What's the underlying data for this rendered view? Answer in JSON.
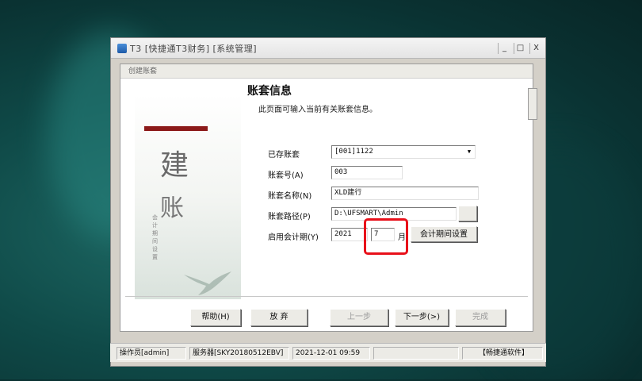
{
  "window": {
    "title": "T3 [快捷通T3财务] [系统管理]",
    "controls": [
      "_",
      "□",
      "X"
    ]
  },
  "dialog": {
    "title": "创建账套"
  },
  "side_panel": {
    "char1": "建",
    "char2": "账",
    "vertical_text": "会计期间设置"
  },
  "content": {
    "title": "账套信息",
    "subtitle": "此页面可输入当前有关账套信息。"
  },
  "form": {
    "existing_label": "已存账套",
    "existing_value": "[001]1122",
    "number_label": "账套号(A)",
    "number_value": "003",
    "name_label": "账套名称(N)",
    "name_value": "XLD建行",
    "path_label": "账套路径(P)",
    "path_value": "D:\\UFSMART\\Admin",
    "period_label": "启用会计期(Y)",
    "period_year": "2021",
    "period_month": "7",
    "month_unit": "月",
    "period_btn": "会计期间设置"
  },
  "buttons": {
    "help": "帮助(H)",
    "cancel": "放 弃",
    "prev": "上一步",
    "next": "下一步(>)",
    "finish": "完成"
  },
  "status_bar": {
    "operator": "操作员[admin]",
    "server": "服务器[SKY20180512EBV]",
    "datetime": "2021-12-01 09:59",
    "brand": "【畅捷通软件】"
  },
  "colors": {
    "highlight": "#e8101a",
    "side_bar_accent": "#8c1a1a"
  }
}
